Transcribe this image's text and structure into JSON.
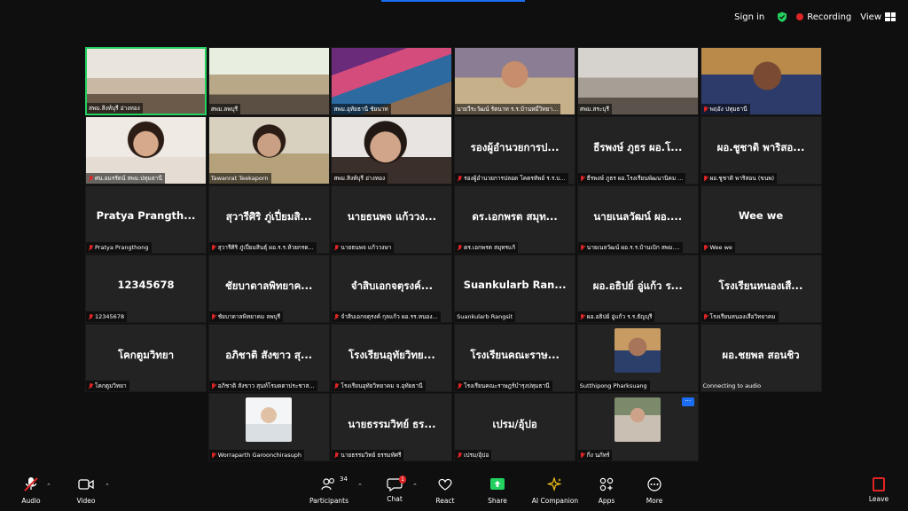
{
  "topbar": {
    "sign_in": "Sign in",
    "recording": "Recording",
    "view": "View"
  },
  "colors": {
    "active_speaker": "#23d160",
    "recording": "#e02424",
    "accent": "#1b6ef3",
    "tile_bg": "#232323"
  },
  "participants": [
    {
      "name": "สพม.สิงห์บุรี อ่างทอง",
      "video": true,
      "muted": false,
      "active": true,
      "scene": "office-a"
    },
    {
      "name": "สพม.ลพบุรี",
      "video": true,
      "muted": false,
      "scene": "meeting-room"
    },
    {
      "name": "สพม.อุทัยธานี ชัยนาท",
      "video": true,
      "muted": false,
      "scene": "colorful-office"
    },
    {
      "name": "นายวีระวัฒน์ รัตนาท ร.ร.บ้านหมี่วิทยา...",
      "video": true,
      "muted": false,
      "scene": "man-uniform"
    },
    {
      "name": "สพม.สระบุรี",
      "video": true,
      "muted": false,
      "scene": "office-b"
    },
    {
      "name": "พฤอัง ปทุมธานี",
      "video": true,
      "muted": true,
      "scene": "man-glasses"
    },
    {
      "name": "ศน.อมรรัตน์ สพม.ปทุมธานี",
      "video": true,
      "muted": true,
      "scene": "woman-white"
    },
    {
      "name": "Tawanrat Teekaporn",
      "video": true,
      "muted": false,
      "scene": "woman-office"
    },
    {
      "name": "สพม.สิงห์บุรี อ่างทอง",
      "video": true,
      "muted": false,
      "scene": "woman-mic"
    },
    {
      "name": "รองผู้อำนวยการปลอด โคตรทัพย์ ร.ร.บ...",
      "big": "รองผู้อำนวยการป...",
      "muted": true
    },
    {
      "name": "ธีรพงษ์ ภูธร ผอ.โรงเรียนพัฒนานิคม ...",
      "big": "ธีรพงษ์ ภูธร ผอ.โ...",
      "muted": true
    },
    {
      "name": "ผอ.ชูชาติ พาริสอน (ขนพ)",
      "big": "ผอ.ชูชาติ พาริสอ...",
      "muted": true
    },
    {
      "name": "Pratya Prangthong",
      "big": "Pratya Prangth...",
      "muted": true
    },
    {
      "name": "สุวารีศิริ ภู่เปี่ยมสินธุ์ ผอ.ร.ร.ห้วยกรด...",
      "big": "สุวารีศิริ ภู่เปี่ยมสิ...",
      "muted": true
    },
    {
      "name": "นายธนพจ แก้ววงษา",
      "big": "นายธนพจ แก้ววง...",
      "muted": true
    },
    {
      "name": "ดร.เอกพรต สมุทรแก้",
      "big": "ดร.เอกพรต สมุท...",
      "muted": true
    },
    {
      "name": "นายเนลวัฒน์ ผอ.ร.ร.บ้านเบิก สพม....",
      "big": "นายเนลวัฒน์ ผอ....",
      "muted": true
    },
    {
      "name": "Wee we",
      "big": "Wee we",
      "muted": true
    },
    {
      "name": "12345678",
      "big": "12345678",
      "muted": true
    },
    {
      "name": "ชัยบาดาลพิทยาคม ลพบุรี",
      "big": "ชัยบาดาลพิทยาค...",
      "muted": true
    },
    {
      "name": "จำสิบเอกจตุรงค์ กุลแก้ว ผอ.รร.หนอง...",
      "big": "จำสิบเอกจตุรงค์...",
      "muted": true
    },
    {
      "name": "Suankularb Rangsit",
      "big": "Suankularb Ran...",
      "muted": false
    },
    {
      "name": "ผอ.อธิปย์ อู่แก้ว ร.ร.ธัญบุรี",
      "big": "ผอ.อธิปย์ อู่แก้ว ร...",
      "muted": true
    },
    {
      "name": "โรงเรียนหนองเสือวิทยาคม",
      "big": "โรงเรียนหนองเสื...",
      "muted": true
    },
    {
      "name": "โคกตูมวิทยา",
      "big": "โคกตูมวิทยา",
      "muted": true
    },
    {
      "name": "อภิชาติ สังขาว สุนท์โรมดตาประชาส...",
      "big": "อภิชาติ สังขาว สุ...",
      "muted": true
    },
    {
      "name": "โรงเรียนอุทัยวิทยาคม จ.อุทัยธานี",
      "big": "โรงเรียนอุทัยวิทย...",
      "muted": true
    },
    {
      "name": "โรงเรียนคณะราษฎร์บำรุงปทุมธานี",
      "big": "โรงเรียนคณะราษ...",
      "muted": true
    },
    {
      "name": "Sutthipong Pharksuang",
      "avatar": true,
      "muted": false,
      "scene": "avatar-man"
    },
    {
      "name": "Connecting to audio",
      "big": "ผอ.ชยพล สอนชิว",
      "muted": false,
      "plain": true
    },
    {
      "name": "Worraparth Garoonchirasuph",
      "avatar": true,
      "muted": true,
      "scene": "avatar-white"
    },
    {
      "name": "นายธรรมวิทย์ ธรรมทัศรี",
      "big": "นายธรรมวิทย์ ธร...",
      "muted": true
    },
    {
      "name": "เปรม/อุ้ปอ",
      "big": "เปรม/อุ้ปอ",
      "muted": true
    },
    {
      "name": "กิ่ง นภัทร์",
      "avatar": true,
      "muted": true,
      "scene": "avatar-woman",
      "more": true
    }
  ],
  "more_badge": "···",
  "toolbar": {
    "audio": "Audio",
    "video": "Video",
    "participants": "Participants",
    "participants_count": "34",
    "chat": "Chat",
    "chat_badge": "1",
    "react": "React",
    "share": "Share",
    "ai_companion": "AI Companion",
    "apps": "Apps",
    "more": "More",
    "leave": "Leave"
  }
}
